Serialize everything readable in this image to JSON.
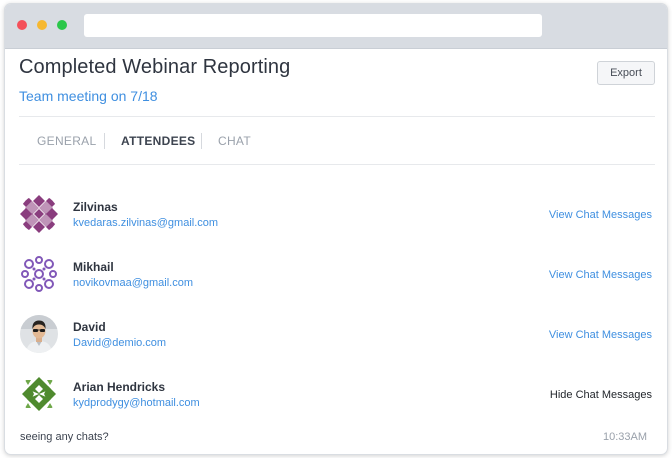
{
  "report": {
    "title": "Completed Webinar Reporting",
    "subtitle": "Team meeting on 7/18",
    "export_label": "Export"
  },
  "tabs": [
    {
      "label": "GENERAL",
      "active": false
    },
    {
      "label": "ATTENDEES",
      "active": true
    },
    {
      "label": "CHAT",
      "active": false
    }
  ],
  "attendees": [
    {
      "name": "Zilvinas",
      "email": "kvedaras.zilvinas@gmail.com",
      "action": "View Chat Messages",
      "avatar": "purple-pattern-avatar"
    },
    {
      "name": "Mikhail",
      "email": "novikovmaa@gmail.com",
      "action": "View Chat Messages",
      "avatar": "violet-pattern-avatar"
    },
    {
      "name": "David",
      "email": "David@demio.com",
      "action": "View Chat Messages",
      "avatar": "photo-avatar"
    },
    {
      "name": "Arian Hendricks",
      "email": "kydprodygy@hotmail.com",
      "action": "Hide Chat Messages",
      "avatar": "green-pattern-avatar"
    }
  ],
  "chat": {
    "message": "seeing any chats?",
    "time": "10:33AM"
  },
  "colors": {
    "accent": "#3f8fe0",
    "titlebar": "#d8dce2",
    "avatar_purple": "#8a3d7e",
    "avatar_violet": "#8158b8",
    "avatar_green": "#4f8a2e"
  }
}
